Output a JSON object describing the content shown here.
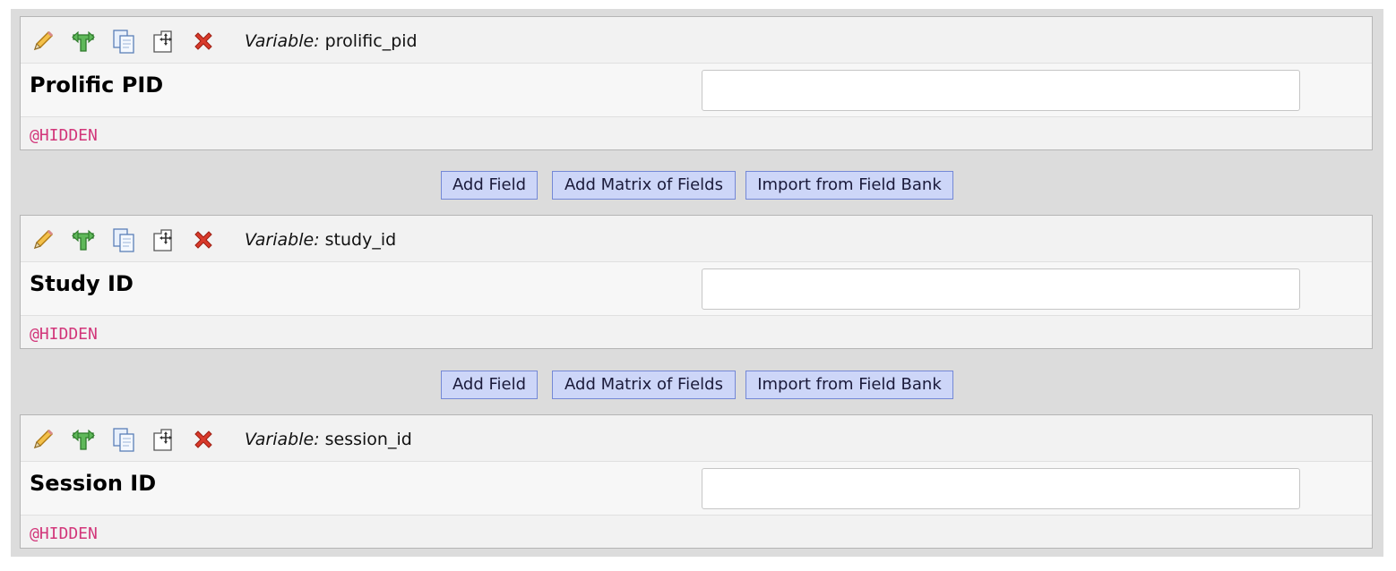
{
  "variable_prefix": "Variable:",
  "annotation_color": "#d2367a",
  "button_color": "#cdd6f8",
  "fields": [
    {
      "variable": "prolific_pid",
      "label": "Prolific PID",
      "annotation": "@HIDDEN",
      "input_value": ""
    },
    {
      "variable": "study_id",
      "label": "Study ID",
      "annotation": "@HIDDEN",
      "input_value": ""
    },
    {
      "variable": "session_id",
      "label": "Session ID",
      "annotation": "@HIDDEN",
      "input_value": ""
    }
  ],
  "add_bar": {
    "add_field": "Add Field",
    "add_matrix": "Add Matrix of Fields",
    "import_bank": "Import from Field Bank"
  },
  "field_icons": [
    "edit-pencil-icon",
    "branching-logic-icon",
    "copy-field-icon",
    "move-field-icon",
    "delete-field-icon"
  ]
}
